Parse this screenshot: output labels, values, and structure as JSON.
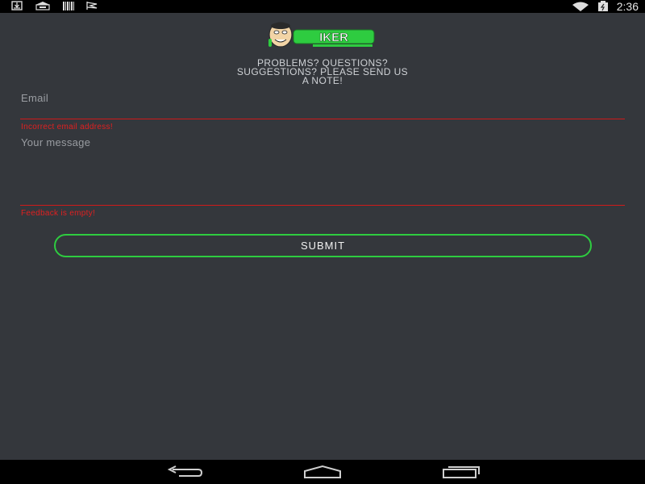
{
  "status_bar": {
    "time": "2:36",
    "left_icons": [
      "download-icon",
      "bag-icon",
      "barcode-icon",
      "flag-icon"
    ],
    "right_icons": [
      "wifi-icon",
      "battery-icon"
    ]
  },
  "logo": {
    "text": "IKER"
  },
  "header": {
    "line1": "PROBLEMS? QUESTIONS?",
    "line2": "SUGGESTIONS? PLEASE SEND US",
    "line3": "A NOTE!"
  },
  "form": {
    "email": {
      "placeholder": "Email",
      "error": "Incorrect email address!"
    },
    "message": {
      "placeholder": "Your message",
      "error": "Feedback is empty!"
    },
    "submit_label": "SUBMIT"
  },
  "colors": {
    "background": "#34373c",
    "error": "#e02020",
    "accent_green": "#2ecc40"
  },
  "nav_bar": {
    "icons": [
      "back-icon",
      "home-icon",
      "recents-icon"
    ]
  }
}
